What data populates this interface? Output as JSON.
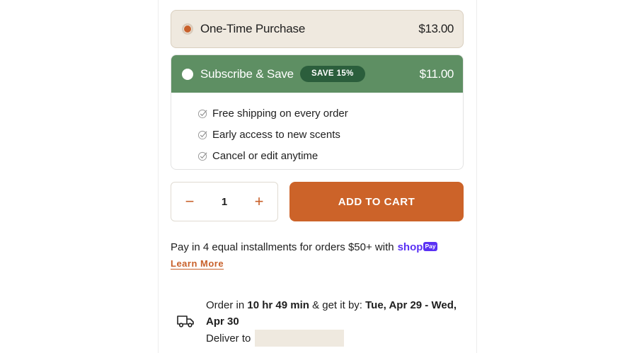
{
  "one_time": {
    "label": "One-Time Purchase",
    "price": "$13.00"
  },
  "subscribe": {
    "label": "Subscribe & Save",
    "badge": "SAVE 15%",
    "price": "$11.00",
    "benefits": [
      "Free shipping on every order",
      "Early access to new scents",
      "Cancel or edit anytime"
    ]
  },
  "quantity": {
    "minus": "−",
    "value": "1",
    "plus": "+"
  },
  "add_to_cart": "ADD TO CART",
  "installments": {
    "text": "Pay in 4 equal installments for orders $50+ with",
    "brand": "shop",
    "badge": "Pay",
    "learn_more": "Learn More"
  },
  "delivery": {
    "prefix": "Order in",
    "countdown": "10 hr 49 min",
    "middle": "& get it by:",
    "date_range": "Tue, Apr 29 - Wed, Apr 30",
    "deliver_to": "Deliver to"
  },
  "colors": {
    "accent": "#cc6329",
    "subscribe_bg": "#5e8f63",
    "badge_bg": "#2b5e3c",
    "onetime_bg": "#efe9df",
    "shop_purple": "#5a31f4"
  }
}
